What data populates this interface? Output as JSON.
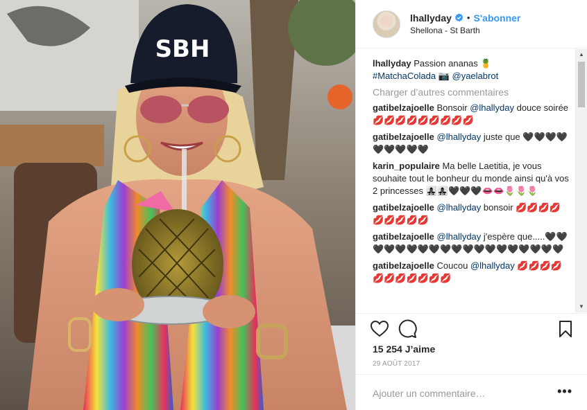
{
  "post": {
    "photo": {
      "cap_text": "SBH",
      "description_icon": "photo-woman-pineapple"
    }
  },
  "header": {
    "username": "lhallyday",
    "verified_icon": "verified-badge-icon",
    "separator": "•",
    "follow_label": "S'abonner",
    "location": "Shellona - St Barth"
  },
  "caption": {
    "username": "lhallyday",
    "text": "Passion ananas 🍍",
    "hashtag": "#MatchaColada",
    "camera_emoji": "📷",
    "mention": "@yaelabrot"
  },
  "load_more_label": "Charger d’autres commentaires",
  "comments": [
    {
      "user": "gatibelzajoelle",
      "pre": "Bonsoir ",
      "mention": "@lhallyday",
      "post": " douce soirée 💋💋💋💋💋💋💋💋💋"
    },
    {
      "user": "gatibelzajoelle",
      "pre": "",
      "mention": "@lhallyday",
      "post": " juste que 🖤🖤🖤🖤🖤🖤🖤🖤🖤"
    },
    {
      "user": "karin_populaire",
      "pre": "Ma belle Laetitia, je vous souhaite tout le bonheur du monde ainsi qu'à vos 2 princesses 👩‍👧‍👧👩‍👧‍👧🖤🖤🖤👄👄🌷🌷🌷",
      "mention": "",
      "post": ""
    },
    {
      "user": "gatibelzajoelle",
      "pre": "",
      "mention": "@lhallyday",
      "post": " bonsoir 💋💋💋💋💋💋💋💋💋"
    },
    {
      "user": "gatibelzajoelle",
      "pre": "",
      "mention": "@lhallyday",
      "post": " j'espère que.....🖤🖤🖤🖤🖤🖤🖤🖤🖤🖤🖤🖤🖤🖤🖤🖤🖤🖤🖤"
    },
    {
      "user": "gatibelzajoelle",
      "pre": "Coucou ",
      "mention": "@lhallyday",
      "post": " 💋💋💋💋💋💋💋💋💋💋💋"
    }
  ],
  "actions": {
    "like_icon": "heart-icon",
    "comment_icon": "comment-bubble-icon",
    "save_icon": "bookmark-icon"
  },
  "likes_text": "15 254 J’aime",
  "date_text": "29 AOÛT 2017",
  "add_comment": {
    "placeholder": "Ajouter un commentaire…",
    "more_label": "•••"
  },
  "colors": {
    "link_blue": "#3897f0",
    "mention_dark": "#003569",
    "muted": "#999999",
    "text": "#262626"
  }
}
